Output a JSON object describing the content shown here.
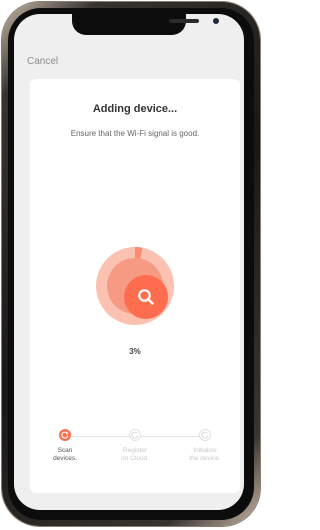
{
  "header": {
    "cancel_label": "Cancel"
  },
  "main": {
    "title": "Adding device...",
    "subtitle": "Ensure that the Wi-Fi signal is good.",
    "progress_text": "3%",
    "progress_value": 0.03
  },
  "steps": [
    {
      "label_line1": "Scan",
      "label_line2": "devices.",
      "state": "active"
    },
    {
      "label_line1": "Register",
      "label_line2": "on Cloud.",
      "state": "pending"
    },
    {
      "label_line1": "Initialize",
      "label_line2": "the device.",
      "state": "pending"
    }
  ],
  "colors": {
    "accent": "#fe6d4e",
    "ring_light": "#fbc1b1",
    "ring_mid": "#f79a83",
    "card_background": "#ffffff",
    "screen_background": "#efefef"
  },
  "icons": {
    "center": "search-icon",
    "step_active": "refresh-icon",
    "step_pending": "refresh-icon"
  }
}
